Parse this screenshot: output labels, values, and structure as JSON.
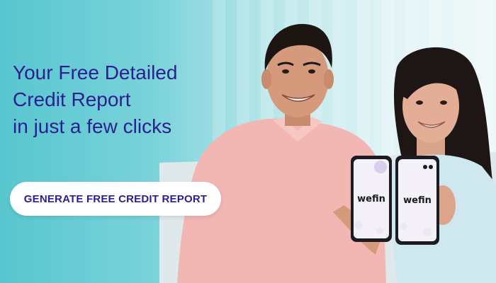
{
  "hero": {
    "headline_lines": [
      "Your Free Detailed",
      "Credit Report",
      "in just a few clicks"
    ],
    "cta_label": "GENERATE FREE CREDIT REPORT"
  },
  "phones": {
    "left_brand": "wefin",
    "right_brand": "wefin"
  },
  "colors": {
    "headline": "#2b1f8f",
    "cta_background": "#ffffff",
    "cta_text": "#2b1f8f",
    "background_accent": "#58c6cf"
  }
}
